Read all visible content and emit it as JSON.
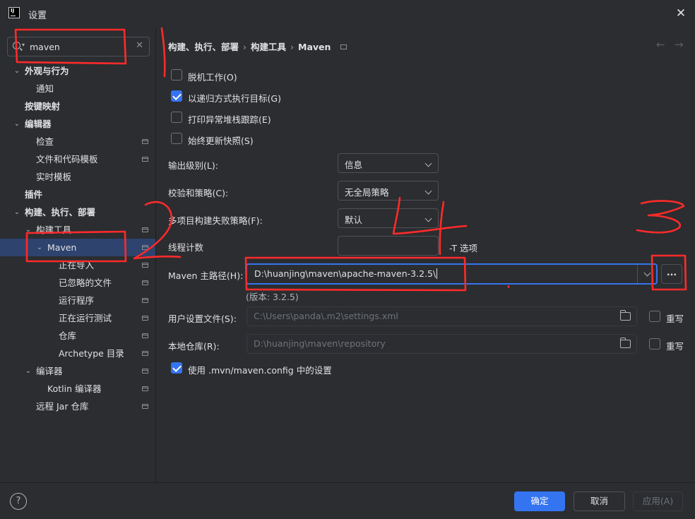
{
  "window": {
    "title": "设置",
    "app_icon_text": "IJ"
  },
  "search": {
    "value": "maven",
    "placeholder": ""
  },
  "tree": [
    {
      "label": "外观与行为",
      "expanded": true,
      "bold": true
    },
    {
      "label": "通知"
    },
    {
      "label": "按键映射",
      "bold": true
    },
    {
      "label": "编辑器",
      "expanded": true,
      "bold": true
    },
    {
      "label": "检查",
      "project_icon": true
    },
    {
      "label": "文件和代码模板",
      "project_icon": true
    },
    {
      "label": "实时模板"
    },
    {
      "label": "插件",
      "bold": true
    },
    {
      "label": "构建、执行、部署",
      "expanded": true,
      "bold": true
    },
    {
      "label": "构建工具",
      "expanded": true,
      "project_icon": true
    },
    {
      "label": "Maven",
      "expanded": true,
      "selected": true,
      "project_icon": true
    },
    {
      "label": "正在导入",
      "project_icon": true
    },
    {
      "label": "已忽略的文件",
      "project_icon": true
    },
    {
      "label": "运行程序",
      "project_icon": true
    },
    {
      "label": "正在运行测试",
      "project_icon": true
    },
    {
      "label": "仓库",
      "project_icon": true
    },
    {
      "label": "Archetype 目录",
      "project_icon": true
    },
    {
      "label": "编译器",
      "expanded": true,
      "project_icon": true
    },
    {
      "label": "Kotlin 编译器",
      "project_icon": true
    },
    {
      "label": "远程 Jar 仓库",
      "project_icon": true
    }
  ],
  "breadcrumb": {
    "part1": "构建、执行、部署",
    "part2": "构建工具",
    "part3": "Maven",
    "sep": "›"
  },
  "nav": {
    "back": "←",
    "forward": "→"
  },
  "options": [
    {
      "label": "脱机工作(O)",
      "checked": false
    },
    {
      "label": "以递归方式执行目标(G)",
      "checked": true
    },
    {
      "label": "打印异常堆栈跟踪(E)",
      "checked": false
    },
    {
      "label": "始终更新快照(S)",
      "checked": false
    }
  ],
  "fields": {
    "output_level_label": "输出级别(L):",
    "output_level_value": "信息",
    "checksum_label": "校验和策略(C):",
    "checksum_value": "无全局策略",
    "multiproject_label": "多项目构建失败策略(F):",
    "multiproject_value": "默认",
    "thread_label": "线程计数",
    "thread_value": "",
    "thread_suffix": "-T 选项",
    "maven_home_label": "Maven 主路径(H):",
    "maven_home_value": "D:\\huanjing\\maven\\apache-maven-3.2.5\\",
    "browse_label": "...",
    "version_text": "(版本: 3.2.5)",
    "user_settings_label": "用户设置文件(S):",
    "user_settings_value": "C:\\Users\\panda\\.m2\\settings.xml",
    "override_label": "重写",
    "local_repo_label": "本地仓库(R):",
    "local_repo_value": "D:\\huanjing\\maven\\repository",
    "use_mvn_config_label": "使用 .mvn/maven.config 中的设置"
  },
  "footer": {
    "help": "?",
    "ok": "确定",
    "cancel": "取消",
    "apply": "应用(A)"
  },
  "colors": {
    "accent": "#3574f0",
    "background": "#2b2d30",
    "selection": "#2e436e",
    "annotation": "#ff2a2a"
  }
}
